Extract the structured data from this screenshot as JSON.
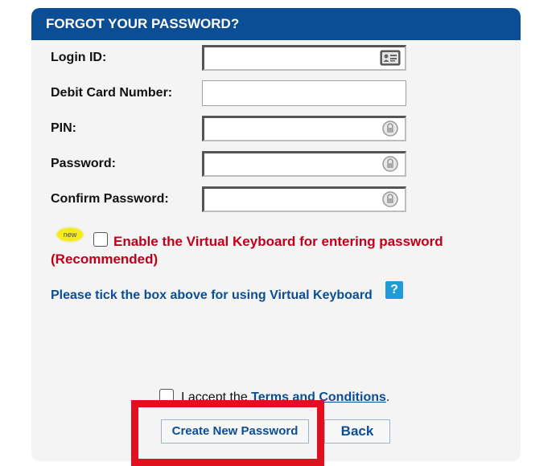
{
  "header": {
    "title": "FORGOT YOUR PASSWORD?"
  },
  "form": {
    "login_id_label": "Login ID:",
    "debit_card_label": "Debit Card Number:",
    "pin_label": "PIN:",
    "password_label": "Password:",
    "confirm_password_label": "Confirm Password:"
  },
  "virtual_keyboard": {
    "new_badge": "new",
    "enable_text_line1": "Enable the Virtual Keyboard for entering password",
    "enable_text_line2": "(Recommended)",
    "help_text": "Please tick the box above for using Virtual Keyboard",
    "help_icon": "?"
  },
  "terms": {
    "accept_prefix": "I accept the ",
    "link_text": "Terms and Conditions",
    "suffix": "."
  },
  "buttons": {
    "create_label": "Create New Password",
    "back_label": "Back"
  },
  "colors": {
    "header_bg": "#0b4e95",
    "accent_red": "#c0001a",
    "highlight_red": "#e0101f",
    "link_blue": "#0b4e95"
  },
  "icons": {
    "login_id": "id-card-icon",
    "pin": "keypad-lock-icon",
    "password": "keypad-lock-icon",
    "confirm_password": "keypad-lock-icon"
  }
}
